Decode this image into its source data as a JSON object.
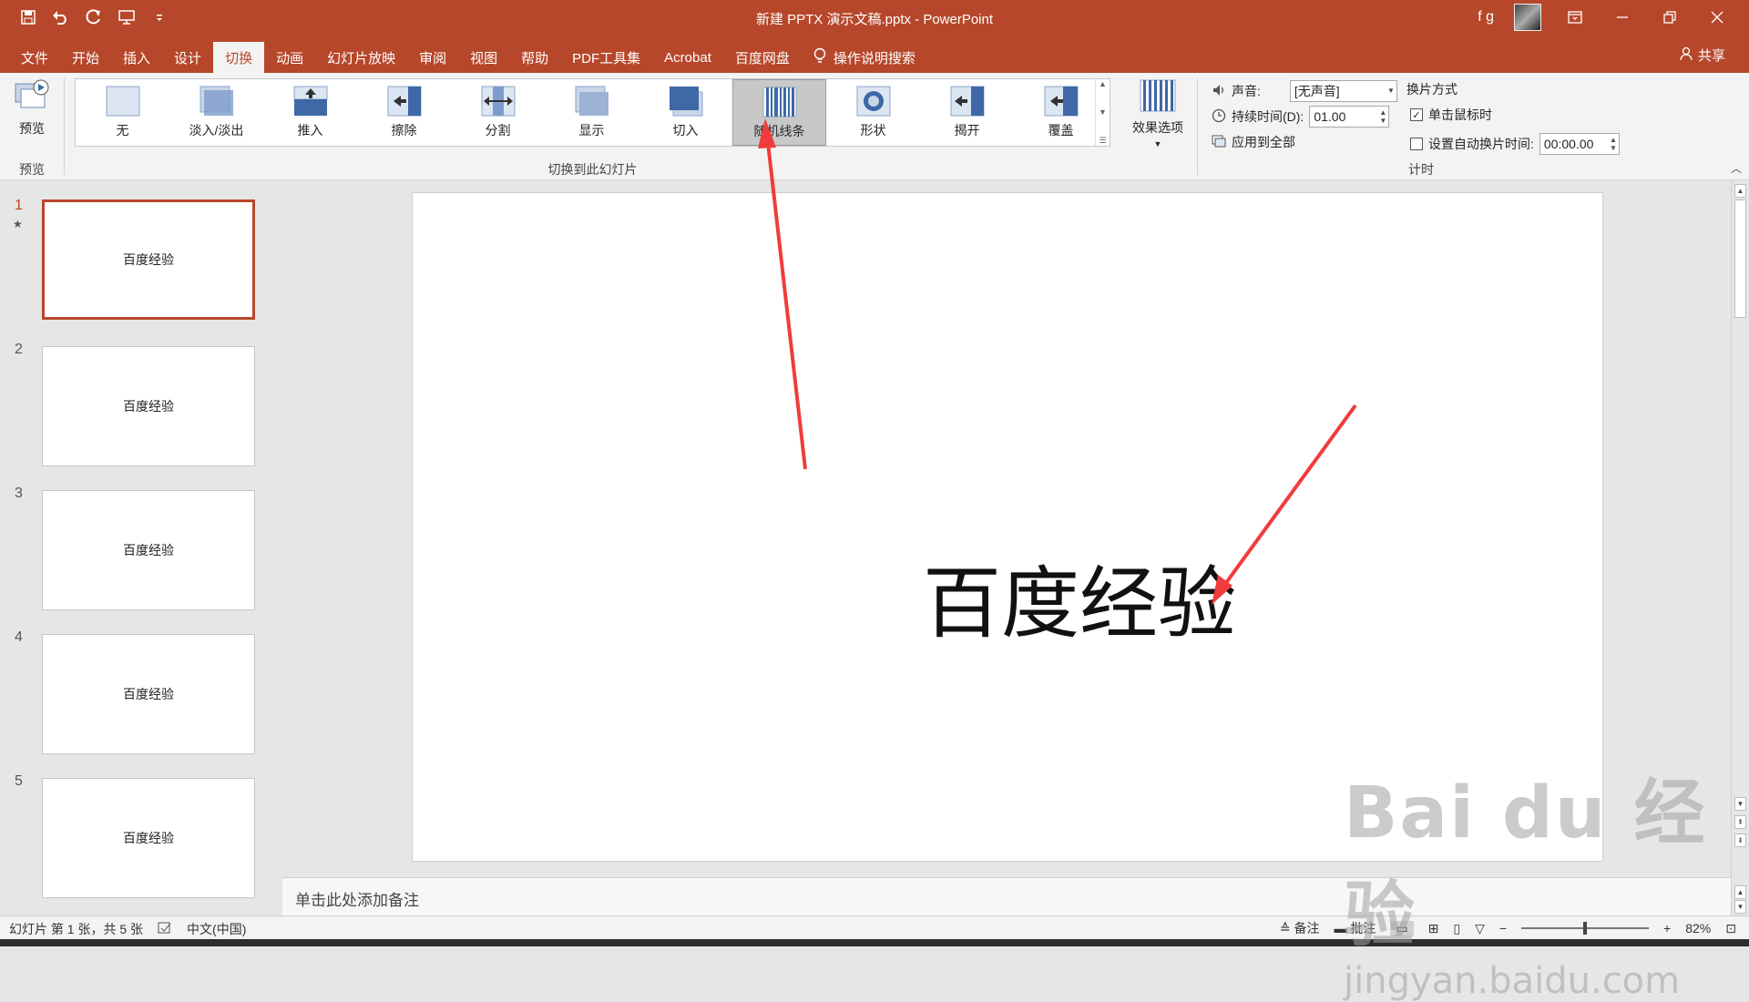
{
  "titlebar": {
    "title": "新建 PPTX 演示文稿.pptx  -  PowerPoint",
    "user": "f g",
    "qat_icons": [
      "save-icon",
      "undo-icon",
      "redo-icon",
      "start-from-beginning-icon",
      "customize-qat-icon"
    ]
  },
  "menu": {
    "tabs": [
      "文件",
      "开始",
      "插入",
      "设计",
      "切换",
      "动画",
      "幻灯片放映",
      "审阅",
      "视图",
      "帮助",
      "PDF工具集",
      "Acrobat",
      "百度网盘"
    ],
    "active_tab": "切换",
    "search": "操作说明搜索",
    "share": "共享"
  },
  "ribbon": {
    "preview_label": "预览",
    "preview_group": "预览",
    "transitions": [
      "无",
      "淡入/淡出",
      "推入",
      "擦除",
      "分割",
      "显示",
      "切入",
      "随机线条",
      "形状",
      "揭开",
      "覆盖"
    ],
    "selected_transition": "随机线条",
    "effect_options": "效果选项",
    "group_transitions": "切换到此幻灯片",
    "sound_label": "声音:",
    "sound_value": "[无声音]",
    "duration_label": "持续时间(D):",
    "duration_value": "01.00",
    "apply_all": "应用到全部",
    "advance_title": "换片方式",
    "on_click": "单击鼠标时",
    "on_click_checked": true,
    "auto_after": "设置自动换片时间:",
    "auto_after_checked": false,
    "auto_after_value": "00:00.00",
    "group_timing": "计时"
  },
  "slides": [
    {
      "num": "1",
      "text": "百度经验"
    },
    {
      "num": "2",
      "text": "百度经验"
    },
    {
      "num": "3",
      "text": "百度经验"
    },
    {
      "num": "4",
      "text": "百度经验"
    },
    {
      "num": "5",
      "text": "百度经验"
    }
  ],
  "current_slide_text": "百度经验",
  "notes_placeholder": "单击此处添加备注",
  "status": {
    "slide_info": "幻灯片 第 1 张，共 5 张",
    "language": "中文(中国)",
    "notes": "备注",
    "comments": "批注",
    "zoom": "82%"
  },
  "watermark": {
    "big": "Bai du 经验",
    "small": "jingyan.baidu.com"
  },
  "colors": {
    "accent": "#b7472a",
    "arrow": "#f03c3c"
  }
}
